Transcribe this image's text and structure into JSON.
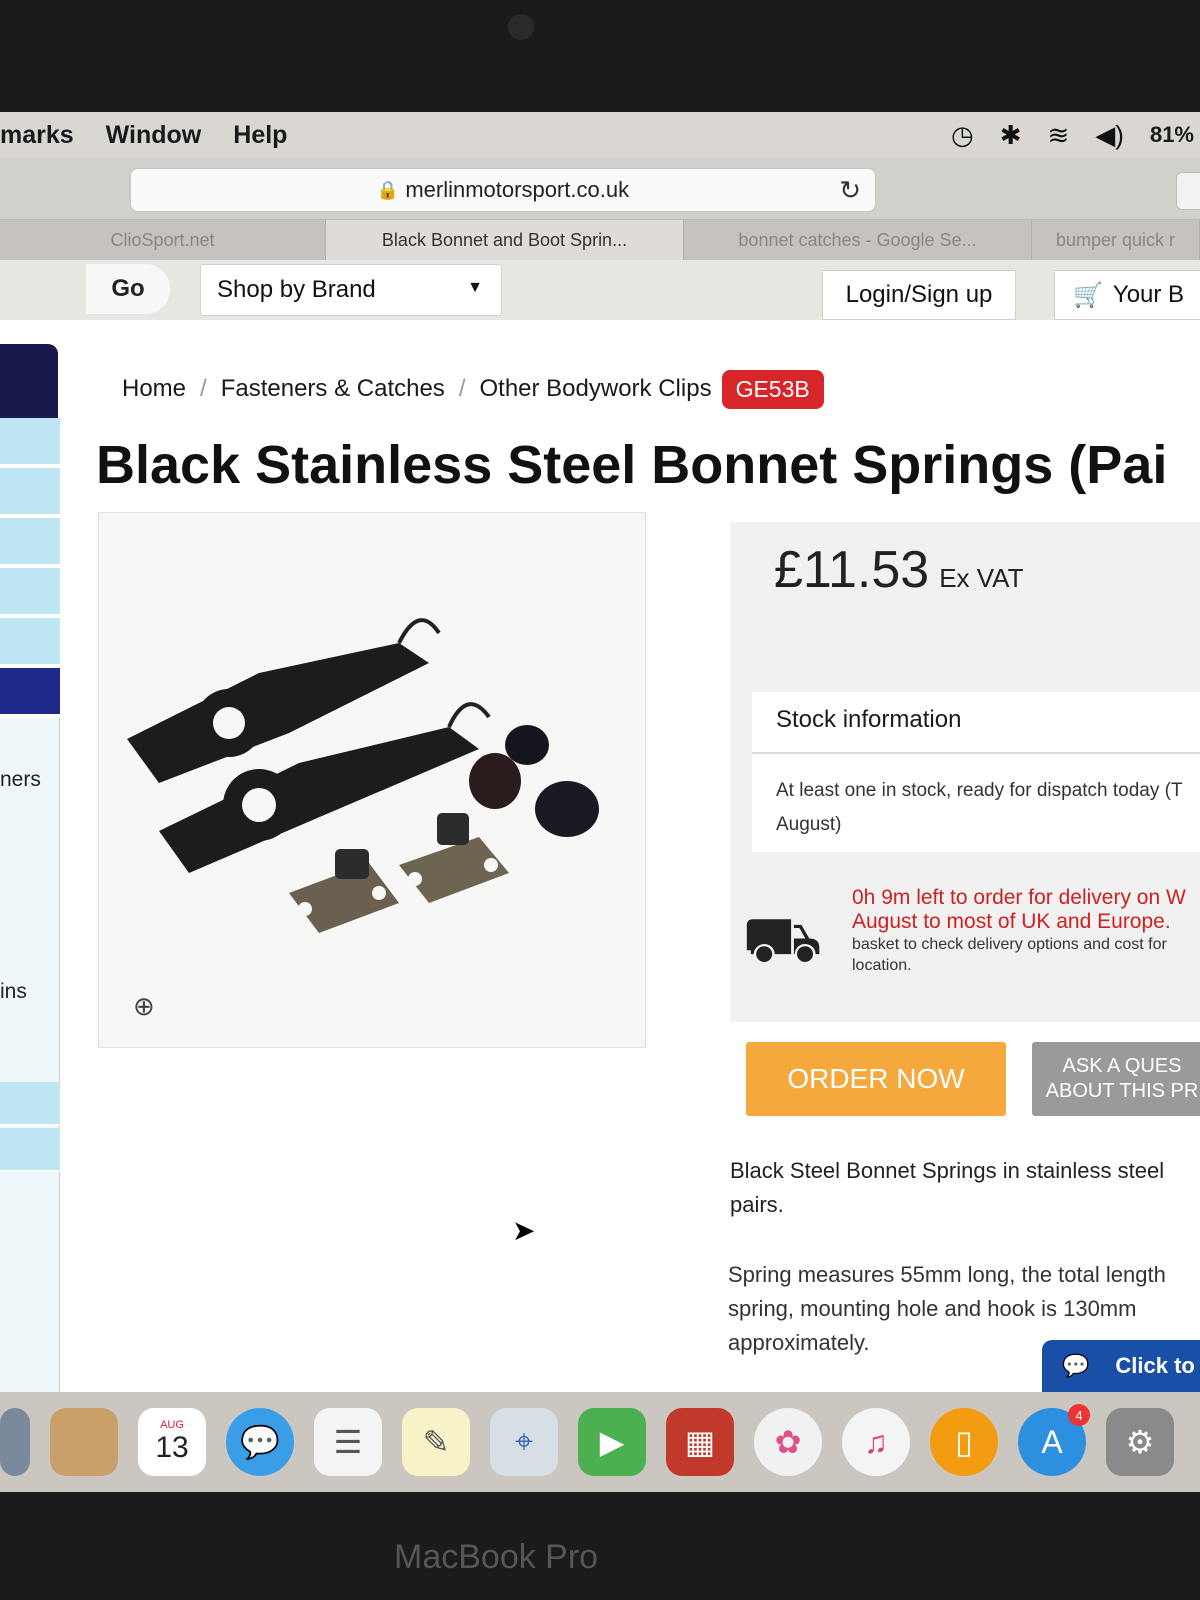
{
  "menubar": {
    "items": [
      "marks",
      "Window",
      "Help"
    ],
    "battery": "81%"
  },
  "browser": {
    "url": "merlinmotorsport.co.uk",
    "tabs": [
      "ClioSport.net",
      "Black Bonnet and Boot Sprin...",
      "bonnet catches - Google Se...",
      "bumper quick r"
    ]
  },
  "site_nav": {
    "go_label": "Go",
    "brand_select": "Shop by Brand",
    "login_label": "Login/Sign up",
    "basket_label": "Your B"
  },
  "sidebar": {
    "labels": [
      "ners",
      "ins"
    ]
  },
  "breadcrumb": {
    "home": "Home",
    "level1": "Fasteners & Catches",
    "level2": "Other Bodywork Clips",
    "sku": "GE53B"
  },
  "product": {
    "title": "Black Stainless Steel Bonnet Springs (Pai",
    "price": "£11.53",
    "vat": "Ex VAT",
    "stock_title": "Stock information",
    "stock_text": "At least one in stock, ready for dispatch today (T August)",
    "delivery_red": "0h 9m left to order for delivery on W August to most of UK and Europe.",
    "delivery_grey": "basket to check delivery options and cost for location.",
    "order_label": "ORDER NOW",
    "ask_line1": "ASK A QUES",
    "ask_line2": "ABOUT THIS PR",
    "description": "Black Steel Bonnet Springs in stainless steel pairs.",
    "description2": "Spring measures 55mm long, the total length spring, mounting hole and hook is 130mm approximately.",
    "chat_label": "Click to"
  },
  "dock": {
    "calendar_month": "AUG",
    "calendar_day": "13",
    "appstore_badge": "4"
  },
  "bezel": {
    "label": "MacBook Pro"
  },
  "colors": {
    "sku_badge": "#d8252a",
    "order_button": "#f5a93c",
    "delivery_text": "#d02020",
    "chat_button": "#1a4fa8"
  }
}
